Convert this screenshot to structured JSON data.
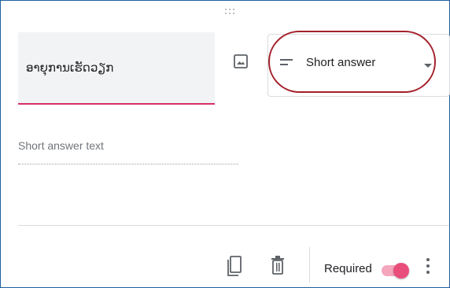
{
  "question": {
    "title": "ອາຍຸການເຮັດວຽກ"
  },
  "question_type": {
    "selected": "Short answer",
    "icon": "short-text-icon"
  },
  "answer": {
    "placeholder": "Short answer text"
  },
  "footer": {
    "required_label": "Required",
    "required_on": true,
    "icons": [
      "copy-icon",
      "trash-icon",
      "more-vert-icon"
    ]
  },
  "colors": {
    "accent": "#e94e7a",
    "underline": "#d93065",
    "highlight_ring": "#a3212b",
    "frame_border": "#1f5f9a"
  }
}
